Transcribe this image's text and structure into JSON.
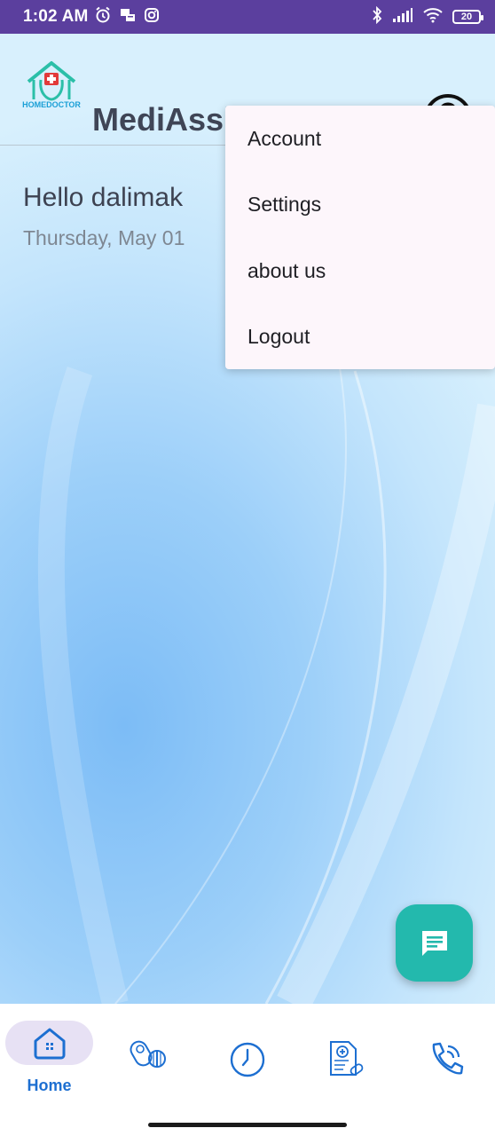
{
  "status_bar": {
    "time": "1:02 AM",
    "left_icons": [
      "alarm-icon",
      "message-icon",
      "instagram-icon"
    ],
    "right_icons": [
      "bluetooth-icon",
      "signal-icon",
      "wifi-icon"
    ],
    "battery_level": "20"
  },
  "header": {
    "logo_text": "HOMEDOCTOR",
    "app_title": "MediAssist",
    "profile_icon": "account-circle-icon"
  },
  "main": {
    "greeting": "Hello dalimak",
    "date": "Thursday, May 01"
  },
  "menu": {
    "items": [
      {
        "label": "Account"
      },
      {
        "label": "Settings"
      },
      {
        "label": "about us"
      },
      {
        "label": "Logout"
      }
    ]
  },
  "fab": {
    "icon": "chat-icon"
  },
  "bottom_nav": {
    "items": [
      {
        "icon": "home-icon",
        "label": "Home",
        "active": true
      },
      {
        "icon": "medicine-icon"
      },
      {
        "icon": "clock-icon"
      },
      {
        "icon": "prescription-icon"
      },
      {
        "icon": "phone-call-icon"
      }
    ]
  },
  "colors": {
    "status_bar": "#5b3f9e",
    "accent": "#1d6fd1",
    "fab": "#23b9ad",
    "nav_active_pill": "#e7e1f4"
  }
}
